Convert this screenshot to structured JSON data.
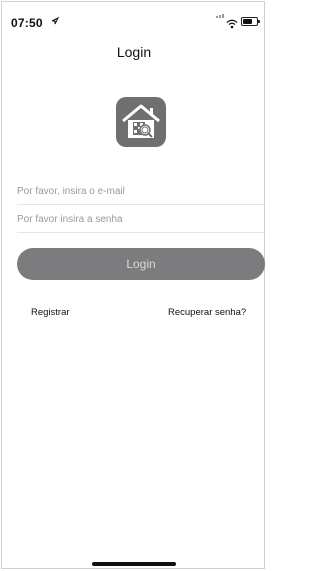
{
  "status_bar": {
    "time": "07:50",
    "location_icon": "location-arrow-icon",
    "signal_icon": "cellular-signal-icon",
    "wifi_icon": "wifi-icon",
    "battery_icon": "battery-icon"
  },
  "header": {
    "title": "Login"
  },
  "app_icon": "home-qr-icon",
  "form": {
    "email_placeholder": "Por favor, insira o e-mail",
    "password_placeholder": "Por favor insira a senha",
    "login_label": "Login"
  },
  "links": {
    "register": "Registrar",
    "recover": "Recuperar senha?"
  },
  "colors": {
    "button_bg": "#7c7c7e",
    "button_text": "#d9d9d9",
    "icon_bg": "#6f6f6f"
  }
}
